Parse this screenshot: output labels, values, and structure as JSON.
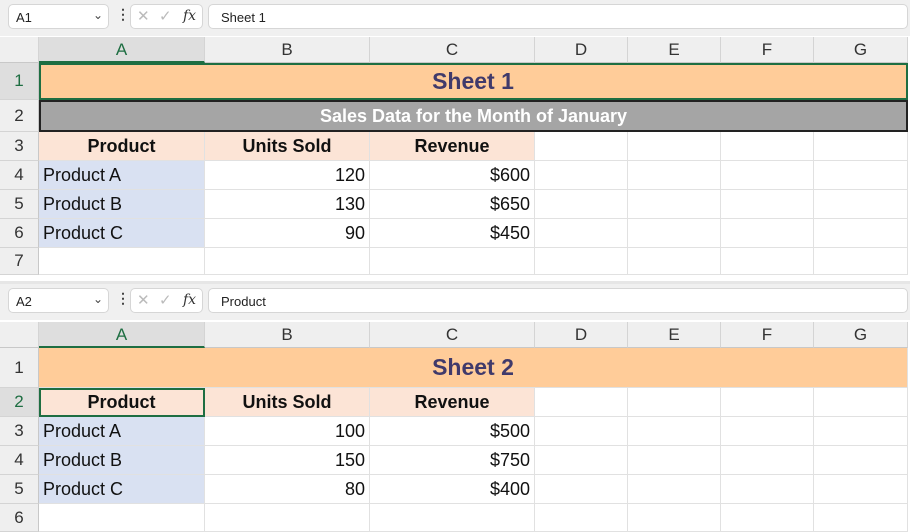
{
  "columns": [
    "A",
    "B",
    "C",
    "D",
    "E",
    "F",
    "G"
  ],
  "sheets": [
    {
      "name_box": "A1",
      "formula": "Sheet 1",
      "active_col": "A",
      "active_row": 1,
      "rows": [
        {
          "num": "1",
          "type": "title",
          "text": "Sheet 1"
        },
        {
          "num": "2",
          "type": "sub",
          "text": "Sales Data for the Month of January"
        },
        {
          "num": "3",
          "type": "header",
          "cells": [
            "Product",
            "Units Sold",
            "Revenue"
          ]
        },
        {
          "num": "4",
          "type": "data",
          "cells": [
            "Product A",
            "120",
            "$600"
          ]
        },
        {
          "num": "5",
          "type": "data",
          "cells": [
            "Product B",
            "130",
            "$650"
          ]
        },
        {
          "num": "6",
          "type": "data",
          "cells": [
            "Product C",
            "90",
            "$450"
          ]
        },
        {
          "num": "7",
          "type": "empty"
        }
      ]
    },
    {
      "name_box": "A2",
      "formula": "Product",
      "active_col": "A",
      "active_row": 2,
      "rows": [
        {
          "num": "1",
          "type": "title",
          "text": "Sheet 2"
        },
        {
          "num": "2",
          "type": "header",
          "cells": [
            "Product",
            "Units Sold",
            "Revenue"
          ]
        },
        {
          "num": "3",
          "type": "data",
          "cells": [
            "Product A",
            "100",
            "$500"
          ]
        },
        {
          "num": "4",
          "type": "data",
          "cells": [
            "Product B",
            "150",
            "$750"
          ]
        },
        {
          "num": "5",
          "type": "data",
          "cells": [
            "Product C",
            "80",
            "$400"
          ]
        },
        {
          "num": "6",
          "type": "empty"
        }
      ]
    }
  ]
}
